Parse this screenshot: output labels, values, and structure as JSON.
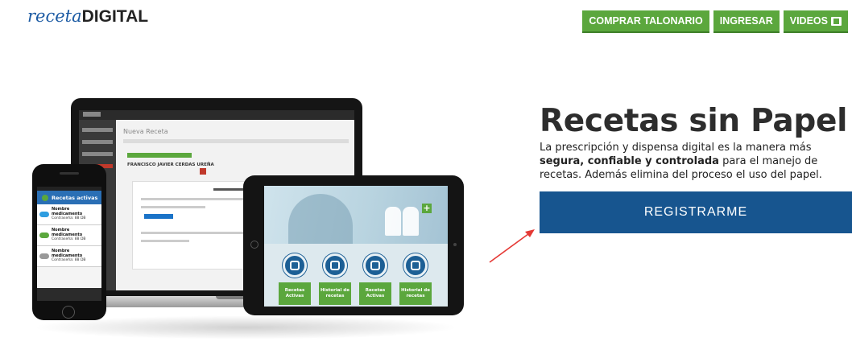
{
  "header": {
    "logo": {
      "part1": "receta",
      "part2": "DIGITAL"
    },
    "nav": [
      {
        "label": "COMPRAR TALONARIO"
      },
      {
        "label": "INGRESAR"
      },
      {
        "label": "VIDEOS"
      }
    ]
  },
  "hero": {
    "title": "Recetas sin Papel",
    "desc_1": "La prescripción y dispensa digital es la manera más ",
    "desc_bold_1": "segura, confiable y controlada",
    "desc_2": " para el manejo de recetas. Además elimina del proceso el uso del papel.",
    "cta": "REGISTRARME"
  },
  "devices": {
    "laptop": {
      "screen_title": "Nueva Receta",
      "patient": "FRANCISCO JAVIER CERDAS UREÑA"
    },
    "phone": {
      "header": "Recetas activas",
      "items": [
        {
          "title": "Nombre medicamento",
          "sub": "Contraseña: 88 DB"
        },
        {
          "title": "Nombre medicamento",
          "sub": "Contraseña: 88 DB"
        },
        {
          "title": "Nombre medicamento",
          "sub": "Contraseña: 88 DB"
        }
      ]
    },
    "tablet": {
      "tiles": [
        {
          "label": "Recetas Activas"
        },
        {
          "label": "Historial de recetas"
        },
        {
          "label": "Recetas Activas"
        },
        {
          "label": "Historial de recetas"
        }
      ]
    }
  },
  "colors": {
    "brand_blue": "#17558f",
    "nav_green": "#5ba73d",
    "logo_blue": "#1b5aa3",
    "arrow_red": "#e53935"
  },
  "icons": {
    "videos": "film-icon",
    "arrow": "annotation-arrow-icon"
  }
}
